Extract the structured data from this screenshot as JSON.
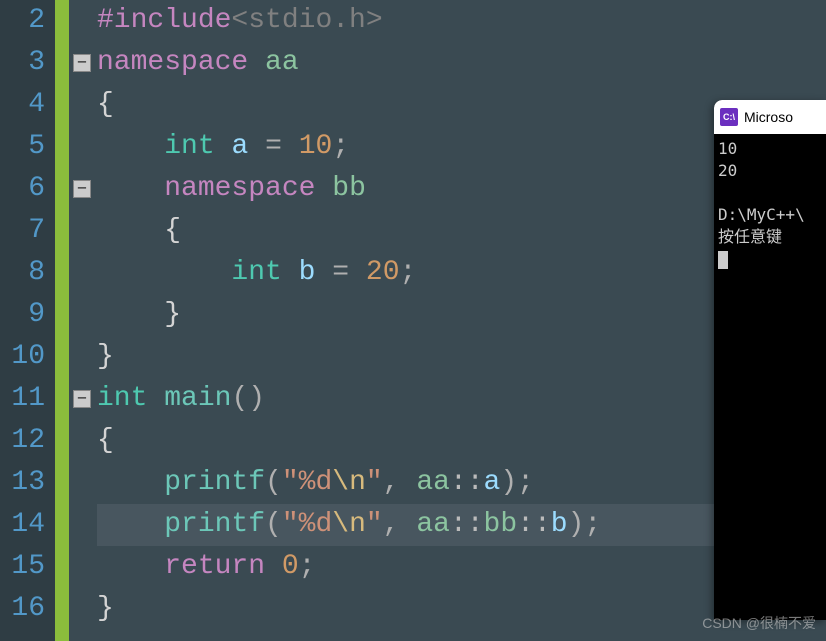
{
  "gutter": {
    "start": 2,
    "end": 16,
    "numbers": [
      "2",
      "3",
      "4",
      "5",
      "6",
      "7",
      "8",
      "9",
      "10",
      "11",
      "12",
      "13",
      "14",
      "15",
      "16"
    ]
  },
  "fold": {
    "collapse_symbol": "−"
  },
  "code": {
    "l2": {
      "preproc": "#include",
      "lt": "<",
      "hdr": "stdio.h",
      "gt": ">"
    },
    "l3": {
      "kw": "namespace",
      "name": "aa"
    },
    "l4": {
      "brace": "{"
    },
    "l5": {
      "type": "int",
      "var": "a",
      "eq": "=",
      "val": "10",
      "semi": ";"
    },
    "l6": {
      "kw": "namespace",
      "name": "bb"
    },
    "l7": {
      "brace": "{"
    },
    "l8": {
      "type": "int",
      "var": "b",
      "eq": "=",
      "val": "20",
      "semi": ";"
    },
    "l9": {
      "brace": "}"
    },
    "l10": {
      "brace": "}"
    },
    "l11": {
      "type": "int",
      "fn": "main",
      "parens": "()"
    },
    "l12": {
      "brace": "{"
    },
    "l13": {
      "fn": "printf",
      "lp": "(",
      "q1": "\"",
      "fmt": "%d",
      "esc": "\\n",
      "q2": "\"",
      "comma": ",",
      "sp": " ",
      "ns1": "aa",
      "cc1": "::",
      "var": "a",
      "rp": ")",
      "semi": ";"
    },
    "l14": {
      "fn": "printf",
      "lp": "(",
      "q1": "\"",
      "fmt": "%d",
      "esc": "\\n",
      "q2": "\"",
      "comma": ",",
      "sp": " ",
      "ns1": "aa",
      "cc1": "::",
      "ns2": "bb",
      "cc2": "::",
      "var": "b",
      "rp": ")",
      "semi": ";"
    },
    "l15": {
      "kw": "return",
      "val": "0",
      "semi": ";"
    },
    "l16": {
      "brace": "}"
    }
  },
  "console": {
    "title": "Microso",
    "icon_text": "C:\\",
    "out1": "10",
    "out2": "20",
    "path": "D:\\MyC++\\",
    "prompt": "按任意键"
  },
  "watermark": "CSDN @很楠不爱"
}
